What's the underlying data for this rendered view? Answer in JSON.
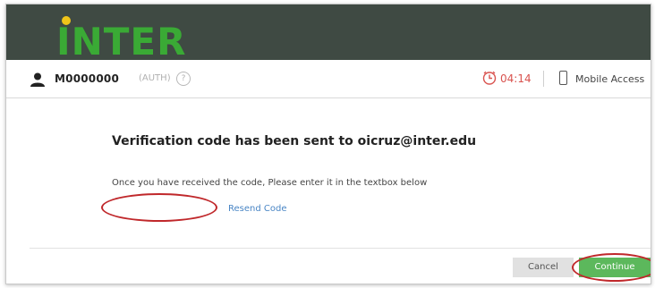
{
  "header": {
    "logo_text": "INTER"
  },
  "topbar": {
    "user_id": "M0000000",
    "auth_label": "(AUTH)",
    "help_glyph": "?",
    "timer": "04:14",
    "mobile_access_label": "Mobile Access"
  },
  "main": {
    "title": "Verification code has been sent to oicruz@inter.edu",
    "instructions": "Once you have received the code, Please enter it in the textbox below",
    "code_value": "",
    "resend_label": "Resend Code"
  },
  "footer": {
    "cancel_label": "Cancel",
    "continue_label": "Continue"
  },
  "colors": {
    "header_bg": "#3f4a43",
    "logo_green": "#3aaa35",
    "logo_dot": "#f0c419",
    "timer_red": "#d9534f",
    "link_blue": "#4a86c5",
    "continue_green": "#5cb85c",
    "annotation_red": "#c0282b"
  },
  "icons": [
    "user-icon",
    "help-icon",
    "clock-icon",
    "phone-icon"
  ]
}
